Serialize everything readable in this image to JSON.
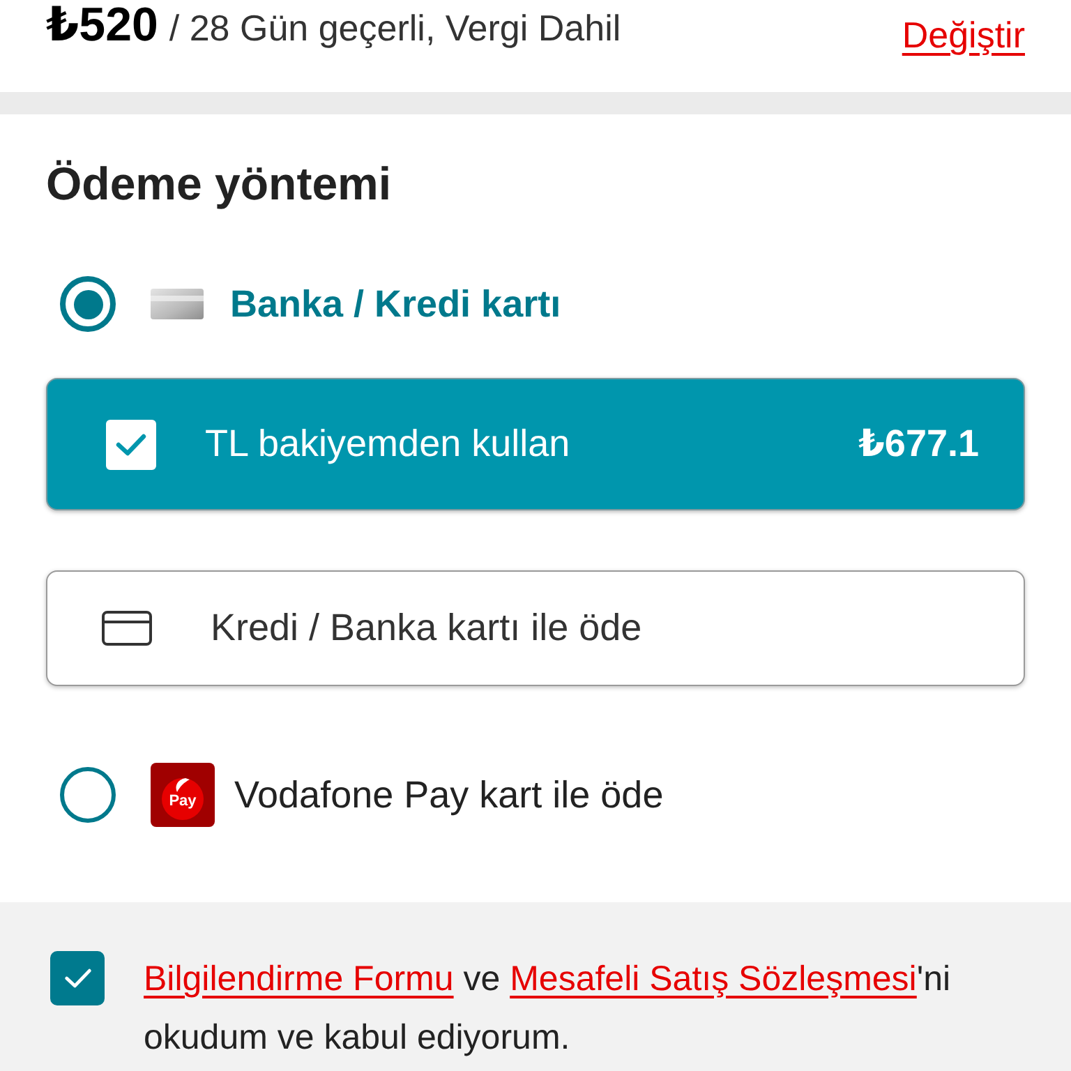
{
  "plan": {
    "price": "₺520",
    "validity": "/ 28 Gün geçerli, Vergi Dahil",
    "change_link": "Değiştir"
  },
  "payment_method": {
    "title": "Ödeme yöntemi",
    "options": [
      {
        "kind": "card",
        "label": "Banka / Kredi kartı",
        "selected": true,
        "balance": {
          "label": "TL bakiyemden kullan",
          "amount": "₺677.1",
          "checked": true
        },
        "card_button": "Kredi / Banka kartı ile öde"
      },
      {
        "kind": "wallet",
        "label": "Vodafone Pay kart ile öde",
        "selected": false,
        "logo_text": "Pay"
      }
    ]
  },
  "agreement": {
    "checked": true,
    "segments": [
      {
        "kind": "link",
        "text": "Bilgilendirme Formu"
      },
      {
        "kind": "text",
        "text": " ve "
      },
      {
        "kind": "link",
        "text": "Mesafeli Satış Sözleşmesi"
      },
      {
        "kind": "text",
        "text": "'ni okudum ve kabul ediyorum."
      }
    ]
  }
}
